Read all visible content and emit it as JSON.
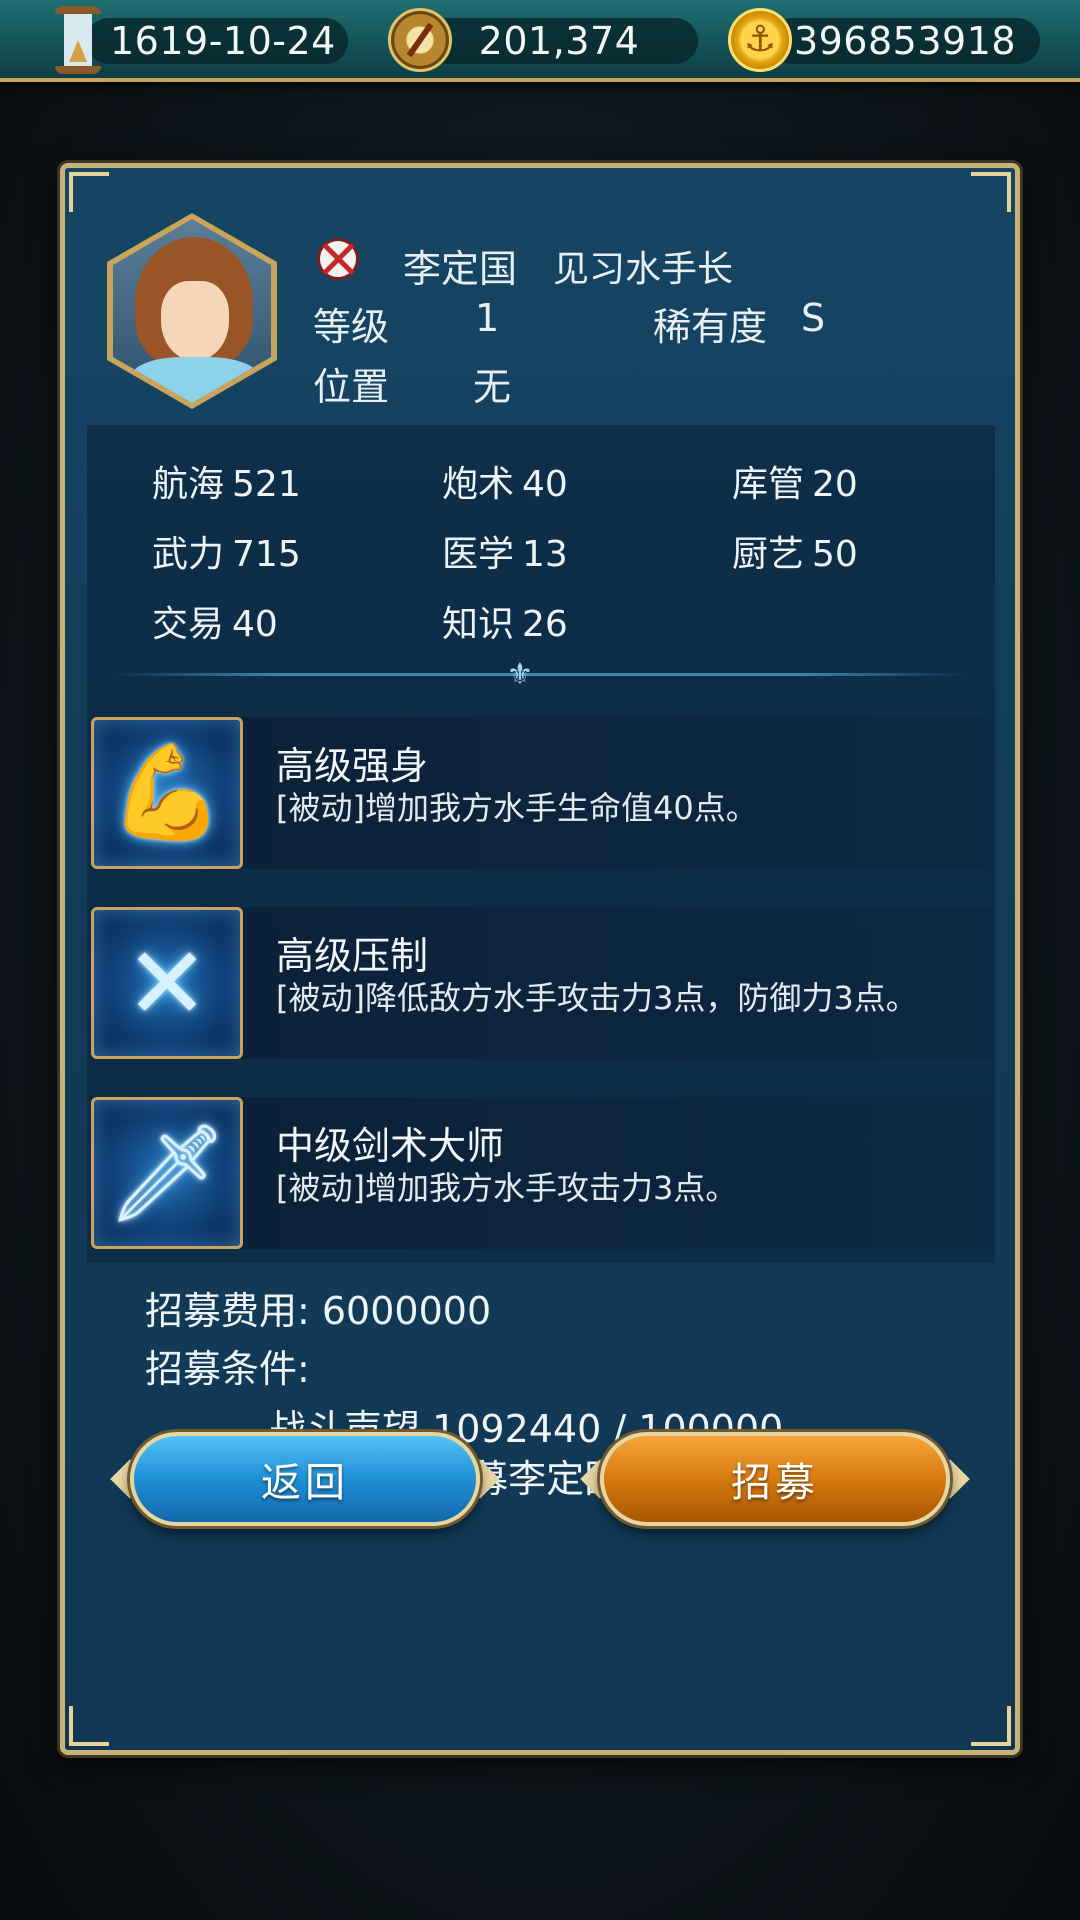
{
  "resources": {
    "date": "1619-10-24",
    "compass_value": "201,374",
    "gold_value": "396853918",
    "icons": [
      "hourglass-icon",
      "compass-icon",
      "gold-anchor-coin-icon"
    ]
  },
  "officer": {
    "name": "李定国",
    "title": "见习水手长",
    "level_label": "等级",
    "level_value": "1",
    "rarity_label": "稀有度",
    "rarity_value": "S",
    "position_label": "位置",
    "position_value": "无",
    "nation_icon": "crossed-flag-icon"
  },
  "stats": [
    {
      "label": "航海",
      "value": "521"
    },
    {
      "label": "炮术",
      "value": "40"
    },
    {
      "label": "库管",
      "value": "20"
    },
    {
      "label": "武力",
      "value": "715"
    },
    {
      "label": "医学",
      "value": "13"
    },
    {
      "label": "厨艺",
      "value": "50"
    },
    {
      "label": "交易",
      "value": "40"
    },
    {
      "label": "知识",
      "value": "26"
    }
  ],
  "skills": [
    {
      "name": "高级强身",
      "desc": "[被动]增加我方水手生命值40点。",
      "icon": "flexed-arm-icon"
    },
    {
      "name": "高级压制",
      "desc": "[被动]降低敌方水手攻击力3点，防御力3点。",
      "icon": "crossed-chains-icon"
    },
    {
      "name": "中级剑术大师",
      "desc": "[被动]增加我方水手攻击力3点。",
      "icon": "sword-icon"
    }
  ],
  "recruit": {
    "cost_text": "招募费用: 6000000",
    "conditions_label": "招募条件:",
    "condition_1": "战斗声望 1092440 / 100000",
    "condition_2": "完成支线 招募李定国·海战勋章"
  },
  "buttons": {
    "back": "返回",
    "recruit": "招募"
  },
  "colors": {
    "panel": "#164665",
    "border_gold": "#c7b37a",
    "back_button": "#1f8fd6",
    "recruit_button": "#d67a10"
  }
}
